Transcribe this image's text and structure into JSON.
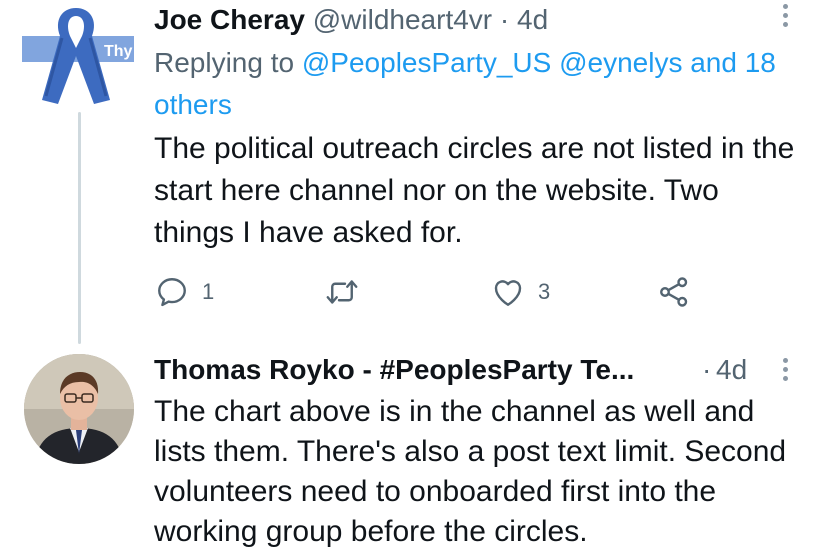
{
  "tweet1": {
    "ribbon_text": "Thy",
    "display_name": "Joe Cheray",
    "handle": "@wildheart4vr",
    "separator": "·",
    "time": "4d",
    "replying_prefix": "Replying to",
    "replying_mentions": "@PeoplesParty_US @eynelys",
    "replying_and": "and",
    "replying_others": "18 others",
    "body": "The political outreach circles are not listed in the start here channel nor on the website. Two things I have asked for.",
    "reply_count": "1",
    "retweet_count": "",
    "like_count": "3"
  },
  "tweet2": {
    "display_name": "Thomas Royko - #PeoplesParty Te...",
    "separator": "·",
    "time": "4d",
    "body": "The chart above is in the channel as well and lists them. There's also a post text limit. Second volunteers need to onboarded first into the working group before the circles."
  },
  "colors": {
    "text": "#0f1419",
    "secondary": "#536471",
    "link": "#1d9bf0",
    "thread_line": "#cfd9de",
    "ribbon": "#4a77c9"
  },
  "icons": [
    "reply-icon",
    "retweet-icon",
    "like-icon",
    "share-icon",
    "more-icon"
  ]
}
